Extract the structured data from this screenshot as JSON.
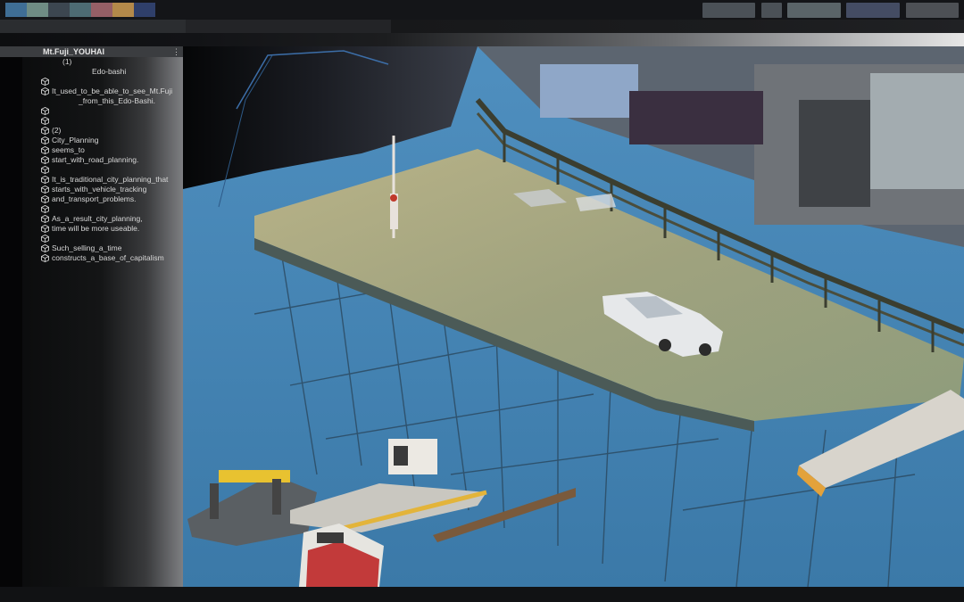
{
  "topbar": {
    "swatch_colors": [
      "#3f6e95",
      "#6f8c84",
      "#3c4650",
      "#4d6b73",
      "#955f66",
      "#b3894a",
      "#2f3f6a"
    ]
  },
  "outliner": {
    "title": "Mt.Fuji_YOUHAI",
    "menu_glyph": "⋮",
    "icon": "cube-icon",
    "rows": [
      {
        "indent": 0,
        "icon": false,
        "text": "(1)"
      },
      {
        "indent": 1,
        "icon": false,
        "text": "Edo-bashi"
      },
      {
        "indent": 0,
        "icon": true,
        "text": ""
      },
      {
        "indent": 0,
        "icon": true,
        "text": "It_used_to_be_able_to_see_Mt.Fuji"
      },
      {
        "indent": 2,
        "icon": false,
        "text": "_from_this_Edo-Bashi."
      },
      {
        "indent": 0,
        "icon": true,
        "text": ""
      },
      {
        "indent": 0,
        "icon": true,
        "text": ""
      },
      {
        "indent": 0,
        "icon": true,
        "text": "(2)"
      },
      {
        "indent": 0,
        "icon": true,
        "text": "City_Planning"
      },
      {
        "indent": 0,
        "icon": true,
        "text": "seems_to"
      },
      {
        "indent": 0,
        "icon": true,
        "text": "start_with_road_planning."
      },
      {
        "indent": 0,
        "icon": true,
        "text": ""
      },
      {
        "indent": 0,
        "icon": true,
        "text": "It_is_traditional_city_planning_that"
      },
      {
        "indent": 0,
        "icon": true,
        "text": "starts_with_vehicle_tracking"
      },
      {
        "indent": 0,
        "icon": true,
        "text": "and_transport_problems."
      },
      {
        "indent": 0,
        "icon": true,
        "text": ""
      },
      {
        "indent": 0,
        "icon": true,
        "text": "As_a_result_city_planning,"
      },
      {
        "indent": 0,
        "icon": true,
        "text": "time will be more useable."
      },
      {
        "indent": 0,
        "icon": true,
        "text": ""
      },
      {
        "indent": 0,
        "icon": true,
        "text": "Such_selling_a_time"
      },
      {
        "indent": 0,
        "icon": true,
        "text": "constructs_a_base_of_capitalism"
      }
    ]
  }
}
